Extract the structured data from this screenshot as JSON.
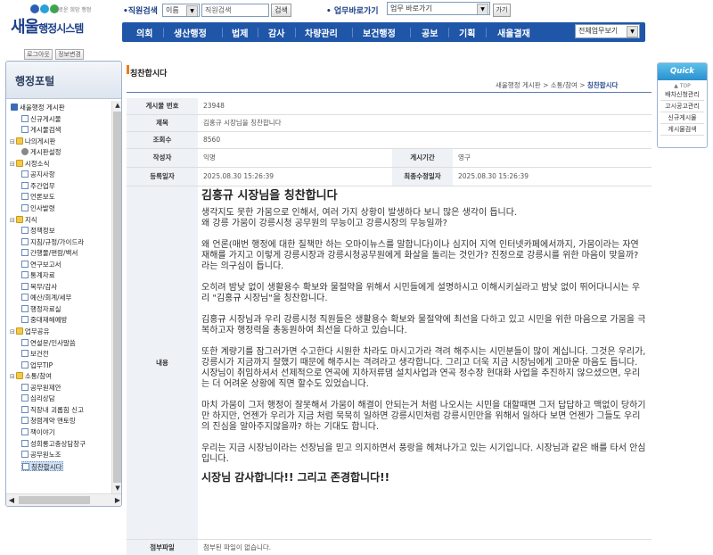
{
  "header": {
    "logo_tagline": "새로운 희망 행정",
    "logo_main": "새울",
    "logo_sub": "행정시스템",
    "staff_search_label": "•직원검색",
    "staff_search_type": "이름",
    "staff_search_placeholder": "직원검색",
    "staff_search_button": "검색",
    "quick_go_label": "• 업무바로가기",
    "quick_go_select": "업무 바로가기",
    "quick_go_button": "가기",
    "logout_button": "로그아웃",
    "info_button": "정보변경"
  },
  "nav": {
    "items": [
      "의회",
      "생산행정",
      "법제",
      "감사",
      "차량관리",
      "보건행정",
      "공보",
      "기획",
      "새울결재"
    ],
    "work_select": "전체업무보기"
  },
  "sidebar": {
    "title": "행정포털",
    "tree": [
      {
        "label": "새울행정 게시판",
        "icon": "root-icon",
        "level": 0
      },
      {
        "label": "신규게시물",
        "icon": "doc-icon",
        "level": 1
      },
      {
        "label": "게시물검색",
        "icon": "doc-icon",
        "level": 1
      },
      {
        "label": "나의게시판",
        "icon": "folder-icon",
        "level": 0
      },
      {
        "label": "게시판설정",
        "icon": "gear-icon",
        "level": 1
      },
      {
        "label": "시정소식",
        "icon": "folder-icon",
        "level": 0
      },
      {
        "label": "공지사항",
        "icon": "doc-icon",
        "level": 1
      },
      {
        "label": "주간업무",
        "icon": "doc-icon",
        "level": 1
      },
      {
        "label": "언론보도",
        "icon": "doc-icon",
        "level": 1
      },
      {
        "label": "인사발령",
        "icon": "doc-icon",
        "level": 1
      },
      {
        "label": "지식",
        "icon": "folder-icon",
        "level": 0
      },
      {
        "label": "정책정보",
        "icon": "doc-icon",
        "level": 1
      },
      {
        "label": "지침/규정/가이드라",
        "icon": "doc-icon",
        "level": 1
      },
      {
        "label": "간행물/편람/백서",
        "icon": "doc-icon",
        "level": 1
      },
      {
        "label": "연구보고서",
        "icon": "doc-icon",
        "level": 1
      },
      {
        "label": "통계자료",
        "icon": "doc-icon",
        "level": 1
      },
      {
        "label": "복무/감사",
        "icon": "doc-icon",
        "level": 1
      },
      {
        "label": "예산/회계/세무",
        "icon": "doc-icon",
        "level": 1
      },
      {
        "label": "행정자료실",
        "icon": "doc-icon",
        "level": 1
      },
      {
        "label": "중대재해예방",
        "icon": "doc-icon",
        "level": 1
      },
      {
        "label": "업무공유",
        "icon": "folder-icon",
        "level": 0
      },
      {
        "label": "연설문/인사말씀",
        "icon": "doc-icon",
        "level": 1
      },
      {
        "label": "보건전",
        "icon": "doc-icon",
        "level": 1
      },
      {
        "label": "업무TIP",
        "icon": "doc-icon",
        "level": 1
      },
      {
        "label": "소통/참여",
        "icon": "folder-icon",
        "level": 0
      },
      {
        "label": "공무원제안",
        "icon": "doc-icon",
        "level": 1
      },
      {
        "label": "심리상담",
        "icon": "doc-icon",
        "level": 1
      },
      {
        "label": "직장내 괴롭힘 신고",
        "icon": "doc-icon",
        "level": 1
      },
      {
        "label": "청렴계약 맨토링",
        "icon": "doc-icon",
        "level": 1
      },
      {
        "label": "책이야기",
        "icon": "doc-icon",
        "level": 1
      },
      {
        "label": "성희롱고충상담창구",
        "icon": "doc-icon",
        "level": 1
      },
      {
        "label": "공무원노조",
        "icon": "doc-icon",
        "level": 1
      },
      {
        "label": "칭찬합시다",
        "icon": "doc-icon",
        "level": 1,
        "selected": true
      }
    ]
  },
  "page": {
    "title": "칭찬합시다",
    "breadcrumb_prefix": "새울행정 게시판 > 소통/참여 > ",
    "breadcrumb_current": "칭찬합시다"
  },
  "post": {
    "labels": {
      "number": "게시물 번호",
      "subject": "제목",
      "views": "조회수",
      "author": "작성자",
      "period": "게시기간",
      "reg_date": "등록일자",
      "mod_date": "최종수정일자",
      "content": "내용",
      "attachment": "첨부파일"
    },
    "number": "23948",
    "subject": "김홍규 시장님을 칭찬합니다",
    "views": "8560",
    "author": "익명",
    "period": "영구",
    "reg_date": "2025.08.30 15:26:39",
    "mod_date": "2025.08.30 15:26:39",
    "content_title": "김홍규 시장님을 칭찬합니다",
    "paragraphs": [
      "생각지도 못한 가뭄으로 인해서, 여러 가지 상황이 발생하다 보니 많은 생각이 듭니다.\n왜 강릉 가뭄이 강릉시청 공무원의 무능이고 강릉시장의 무능일까?",
      "왜 언론(매번 행정에 대한 질책만 하는 오마이뉴스를 말합니다)이나 심지어 지역 인터넷카페에서까지, 가뭄이라는 자연 재해를 가지고 이렇게 강릉시장과 강릉시청공무원에게 화살을 돌리는 것인가? 진정으로 강릉시를 위한 마음이 맞을까? 라는 의구심이 듭니다.",
      " 오히려 밤낮 없이 생활용수 확보와 물절약을 위해서 시민들에게 설명하시고 이해시키실라고  밤낮 없이 뛰어다니시는 우리 \"김홍규 시장님\"을 칭찬합니다.",
      "김홍규 시장님과 우리 강릉시청 직원들은 생활용수 확보와 물절약에 최선을 다하고 있고 시민을 위한 마음으로 가뭄을 극복하고자 행정력을 총동원하여 최선을 다하고 있습니다.",
      "또한 계량기를 잠그러가면 수고한다 시원한 차라도 마시고가라 격려 해주시는 시민분들이 많이 계십니다. 그것은 우리가, 강릉시가 지금까지 잘했기 때문에 해주시는 격려라고 생각합니다. 그리고 더욱 지금 시장님에게 고마운 마음도 듭니다. 시장님이 취임하셔서 선제적으로 연곡에 지하저류댐 설치사업과 연곡 정수장 현대화 사업을 추진하지 않으셨으면, 우리는 더 어려운 상황에 직면 할수도 있었습니다.",
      "마치 가뭄이 그저 행정이 잘못해서 가뭄이 해결이 안되는거 처럼 나오시는 시민을 대할때면 그저 답답하고 맥없이 당하기만 하지만, 언젠가 우리가 지금 처럼 묵묵히 일하면 강릉시민처럼 강릉시민만을 위해서 일하다 보면 언젠가 그들도 우리의 진심을 알아주지않을까? 하는 기대도 합니다.",
      "우리는 지금 시장님이라는 선장님을 믿고 의지하면서 풍랑을 헤쳐나가고 있는 시기입니다. 시장님과 같은 배를 타서 안심입니다."
    ],
    "closing": "시장님 감사합니다!! 그리고 존경합니다!!",
    "attachment": "첨부된 파일이 없습니다."
  },
  "quick_menu": {
    "title": "Quick Menu",
    "top": "▲ TOP",
    "items": [
      "배차신청관리",
      "고시공고관리",
      "신규게시물",
      "게시물검색"
    ]
  },
  "colors": {
    "nav_bg": "#1f56a8",
    "accent_orange": "#e87b1a",
    "logo_blue": "#1d3f8a"
  }
}
